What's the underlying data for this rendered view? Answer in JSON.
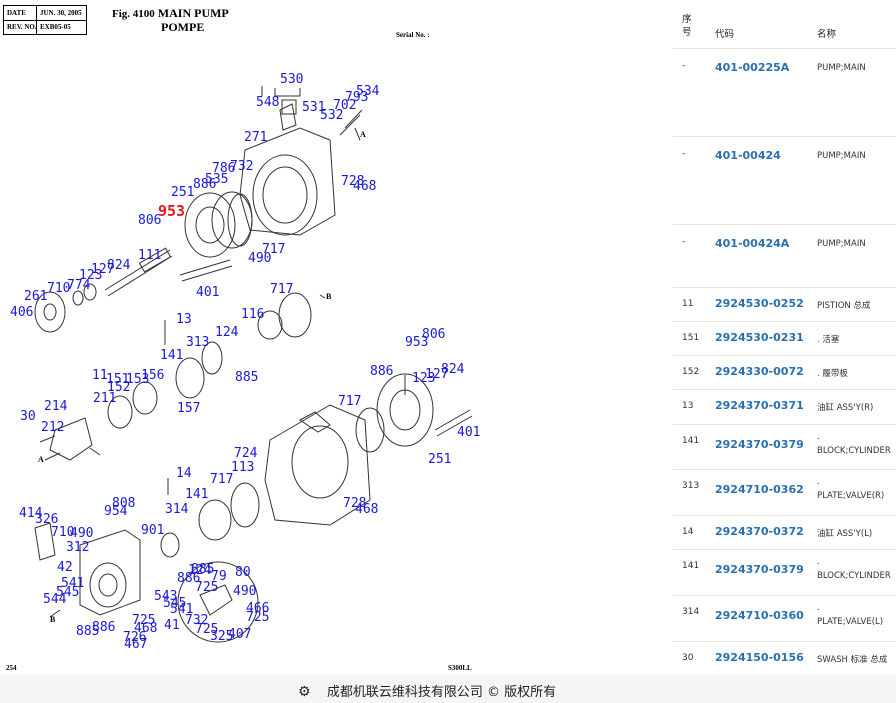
{
  "header": {
    "date_label": "DATE",
    "date_value": "JUN. 30, 2005",
    "rev_label": "REV. NO.",
    "rev_value": "EXB05-05",
    "fig_label": "Fig. 4100",
    "title_en": "MAIN PUMP",
    "title_fr": "POMPE",
    "serial_label": "Serial No. :"
  },
  "diagram": {
    "page_number": "254",
    "model": "S300LL",
    "section_labels": {
      "a1": "A",
      "a2": "A",
      "b1": "B",
      "b2": "B"
    },
    "callouts": [
      "530",
      "548",
      "531",
      "702",
      "793",
      "534",
      "532",
      "271",
      "732",
      "786",
      "535",
      "886",
      "251",
      "728",
      "468",
      "953",
      "806",
      "717",
      "490",
      "111",
      "824",
      "127",
      "123",
      "774",
      "710",
      "261",
      "406",
      "401",
      "717",
      "116",
      "13",
      "313",
      "124",
      "141",
      "885",
      "11",
      "151",
      "153",
      "156",
      "152",
      "157",
      "211",
      "214",
      "30",
      "212",
      "806",
      "953",
      "824",
      "127",
      "123",
      "886",
      "717",
      "401",
      "724",
      "113",
      "251",
      "14",
      "717",
      "141",
      "314",
      "728",
      "468",
      "808",
      "954",
      "901",
      "414",
      "326",
      "710",
      "490",
      "312",
      "42",
      "541",
      "545",
      "544",
      "885",
      "124",
      "79",
      "886",
      "80",
      "543",
      "725",
      "545",
      "490",
      "541",
      "466",
      "725",
      "41",
      "732",
      "725",
      "725",
      "886",
      "468",
      "467",
      "726",
      "885",
      "325",
      "407"
    ],
    "highlight_callout": "953"
  },
  "table": {
    "headers": {
      "seq": "序\n号",
      "code": "代码",
      "name": "名称"
    },
    "rows": [
      {
        "seq": "-",
        "code": "401-00225A",
        "name": "PUMP;MAIN"
      },
      {
        "seq": "-",
        "code": "401-00424",
        "name": "PUMP;MAIN"
      },
      {
        "seq": "-",
        "code": "401-00424A",
        "name": "PUMP;MAIN"
      },
      {
        "seq": "11",
        "code": "2924530-0252",
        "name": "PISTION 总成"
      },
      {
        "seq": "151",
        "code": "2924530-0231",
        "name": ". 活塞"
      },
      {
        "seq": "152",
        "code": "2924330-0072",
        "name": ". 履带板"
      },
      {
        "seq": "13",
        "code": "2924370-0371",
        "name": "油缸 ASS'Y(R)"
      },
      {
        "seq": "141",
        "code": "2924370-0379",
        "name": ".\nBLOCK;CYLINDER"
      },
      {
        "seq": "313",
        "code": "2924710-0362",
        "name": ".\nPLATE;VALVE(R)"
      },
      {
        "seq": "14",
        "code": "2924370-0372",
        "name": "油缸 ASS'Y(L)"
      },
      {
        "seq": "141",
        "code": "2924370-0379",
        "name": ".\nBLOCK;CYLINDER"
      },
      {
        "seq": "314",
        "code": "2924710-0360",
        "name": ".\nPLATE;VALVE(L)"
      },
      {
        "seq": "30",
        "code": "2924150-0156",
        "name": "SWASH 标准 总成"
      }
    ]
  },
  "footer": {
    "icon": "gear-icon",
    "company": "成都机联云维科技有限公司",
    "copyright_symbol": "©",
    "rights": "版权所有"
  },
  "colors": {
    "callout": "#1a1ad4",
    "highlight": "#e41a1a",
    "code": "#2a6fb0"
  }
}
